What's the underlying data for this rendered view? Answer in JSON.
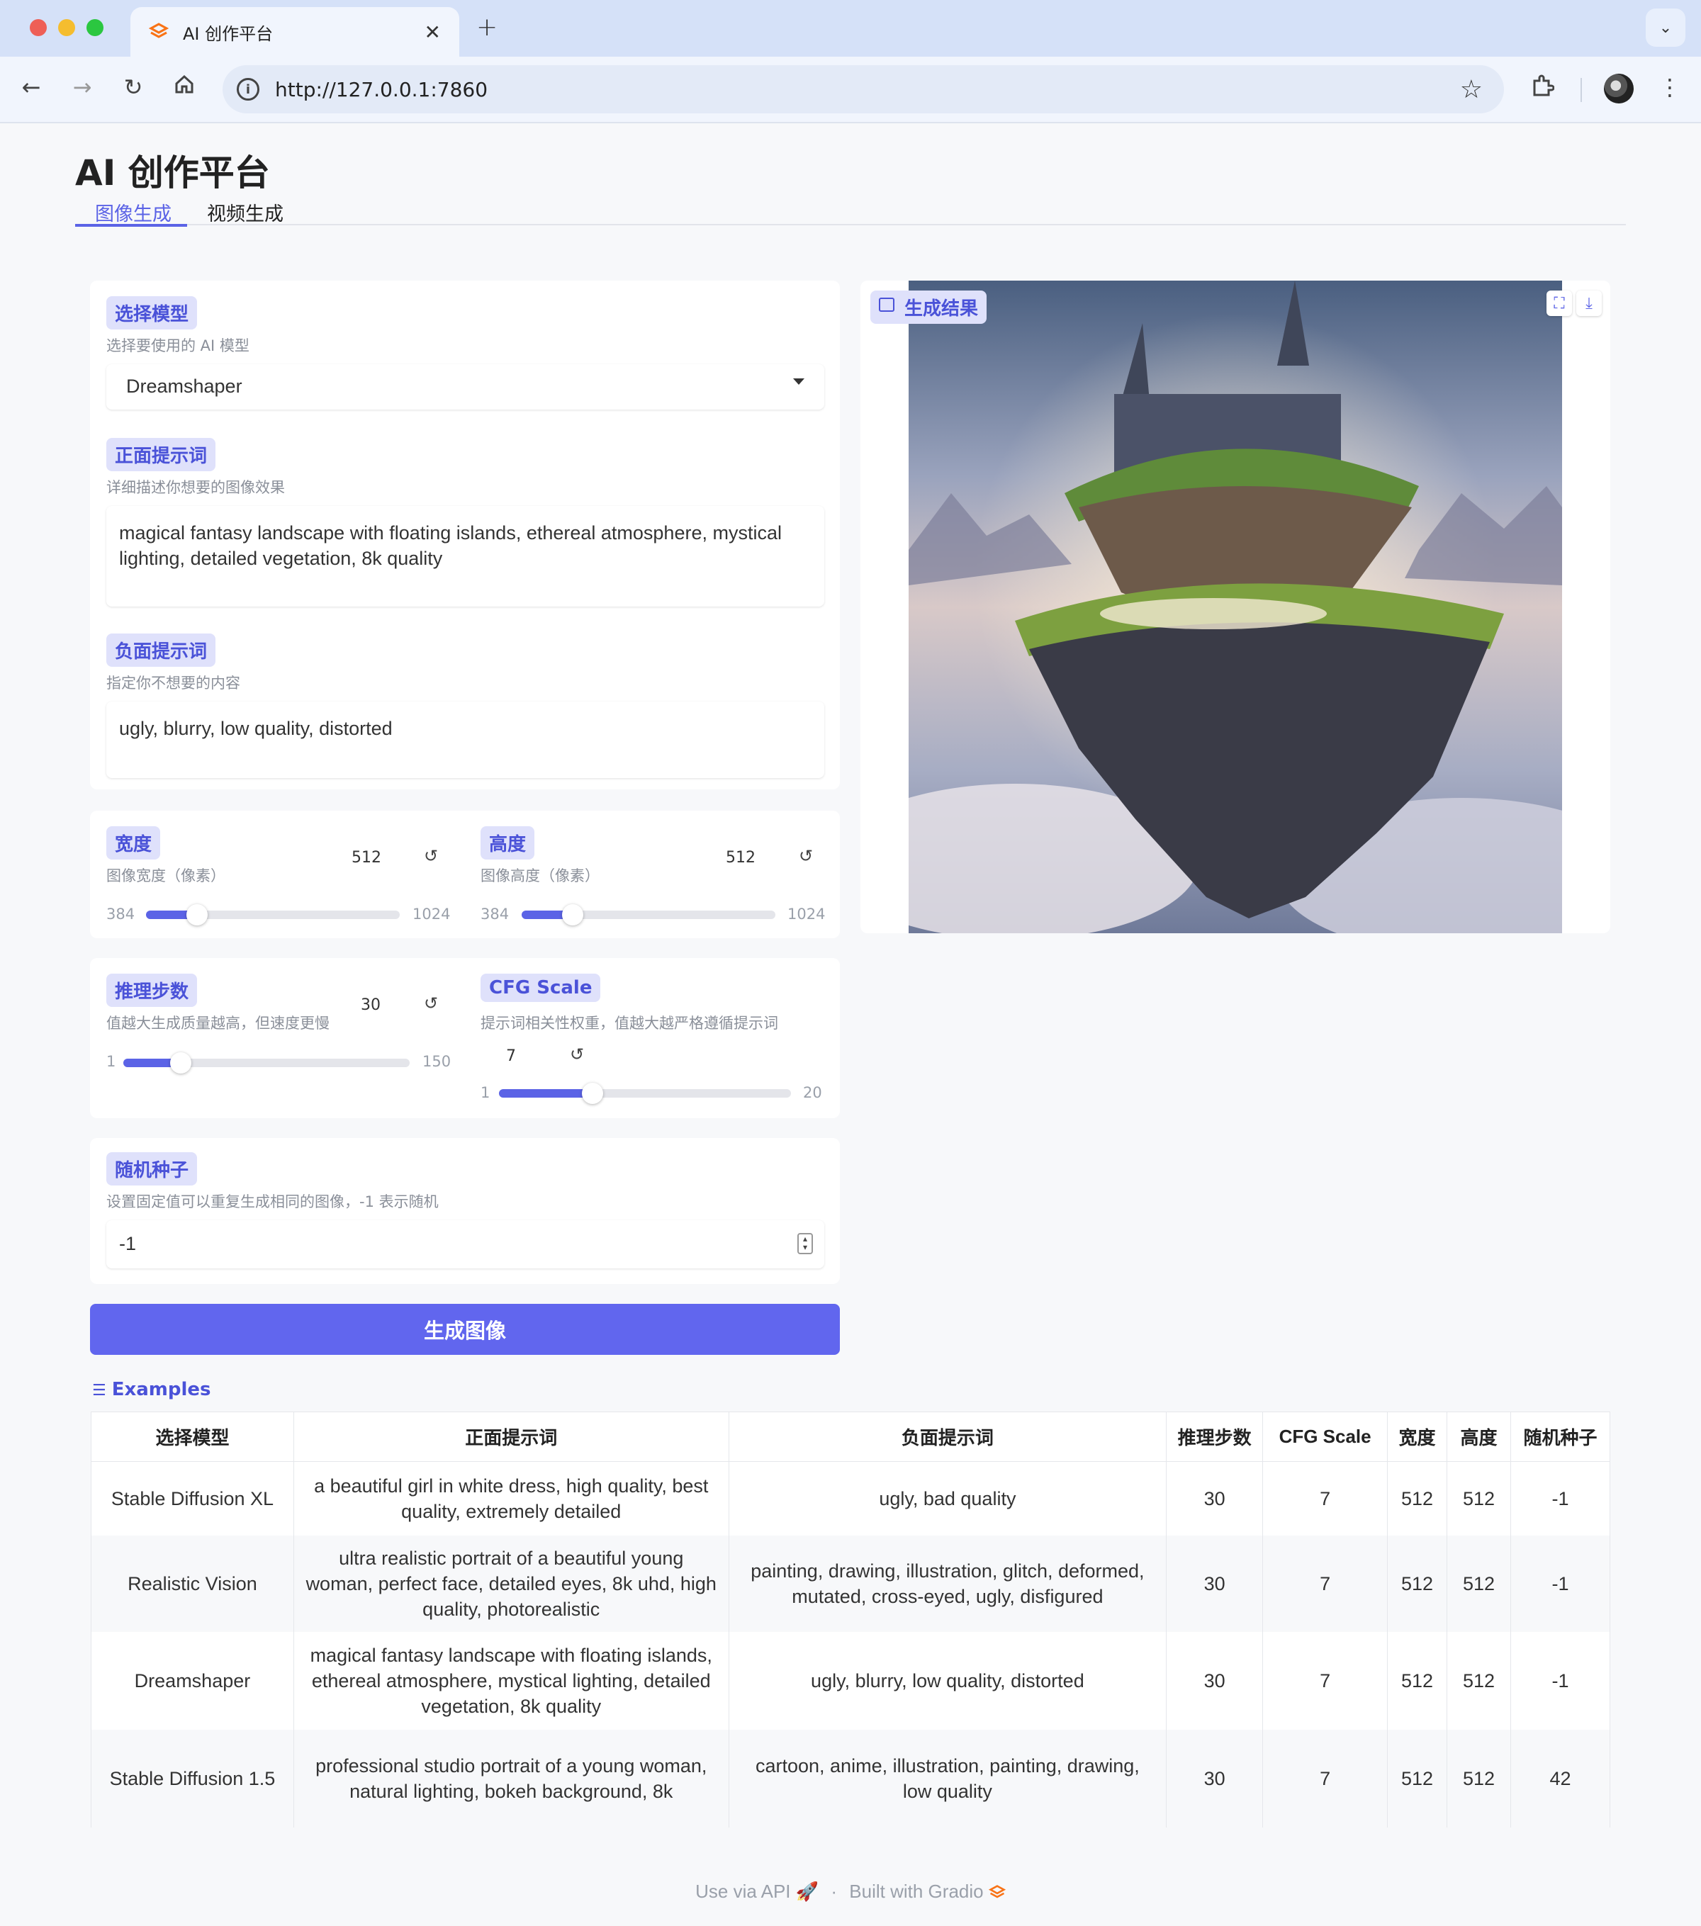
{
  "browser": {
    "tab_title": "AI 创作平台",
    "url": "http://127.0.0.1:7860",
    "new_tab": "+",
    "tab_close": "✕"
  },
  "page": {
    "title": "AI 创作平台",
    "tabs": [
      "图像生成",
      "视频生成"
    ]
  },
  "model": {
    "label": "选择模型",
    "info": "选择要使用的 AI 模型",
    "value": "Dreamshaper"
  },
  "positive": {
    "label": "正面提示词",
    "info": "详细描述你想要的图像效果",
    "value": "magical fantasy landscape with floating islands, ethereal atmosphere, mystical lighting, detailed vegetation, 8k quality"
  },
  "negative": {
    "label": "负面提示词",
    "info": "指定你不想要的内容",
    "value": "ugly, blurry, low quality, distorted"
  },
  "width": {
    "label": "宽度",
    "info": "图像宽度（像素）",
    "value": "512",
    "min": "384",
    "max": "1024",
    "level": 0.2
  },
  "height": {
    "label": "高度",
    "info": "图像高度（像素）",
    "value": "512",
    "min": "384",
    "max": "1024",
    "level": 0.2
  },
  "steps": {
    "label": "推理步数",
    "info": "值越大生成质量越高，但速度更慢",
    "value": "30",
    "min": "1",
    "max": "150",
    "level": 0.2
  },
  "cfg": {
    "label": "CFG Scale",
    "info": "提示词相关性权重，值越大越严格遵循提示词",
    "value": "7",
    "min": "1",
    "max": "20",
    "level": 0.32
  },
  "seed": {
    "label": "随机种子",
    "info": "设置固定值可以重复生成相同的图像，-1 表示随机",
    "value": "-1"
  },
  "generate_button": "生成图像",
  "result": {
    "label": "生成结果"
  },
  "examples": {
    "title": "Examples",
    "headers": [
      "选择模型",
      "正面提示词",
      "负面提示词",
      "推理步数",
      "CFG Scale",
      "宽度",
      "高度",
      "随机种子"
    ],
    "rows": [
      [
        "Stable Diffusion XL",
        "a beautiful girl in white dress, high quality, best quality, extremely detailed",
        "ugly, bad quality",
        "30",
        "7",
        "512",
        "512",
        "-1"
      ],
      [
        "Realistic Vision",
        "ultra realistic portrait of a beautiful young woman, perfect face, detailed eyes, 8k uhd, high quality, photorealistic",
        "painting, drawing, illustration, glitch, deformed, mutated, cross-eyed, ugly, disfigured",
        "30",
        "7",
        "512",
        "512",
        "-1"
      ],
      [
        "Dreamshaper",
        "magical fantasy landscape with floating islands, ethereal atmosphere, mystical lighting, detailed vegetation, 8k quality",
        "ugly, blurry, low quality, distorted",
        "30",
        "7",
        "512",
        "512",
        "-1"
      ],
      [
        "Stable Diffusion 1.5",
        "professional studio portrait of a young woman, natural lighting, bokeh background, 8k",
        "cartoon, anime, illustration, painting, drawing, low quality",
        "30",
        "7",
        "512",
        "512",
        "42"
      ]
    ]
  },
  "footer": {
    "api": "Use via API",
    "sep": "·",
    "built": "Built with Gradio"
  }
}
